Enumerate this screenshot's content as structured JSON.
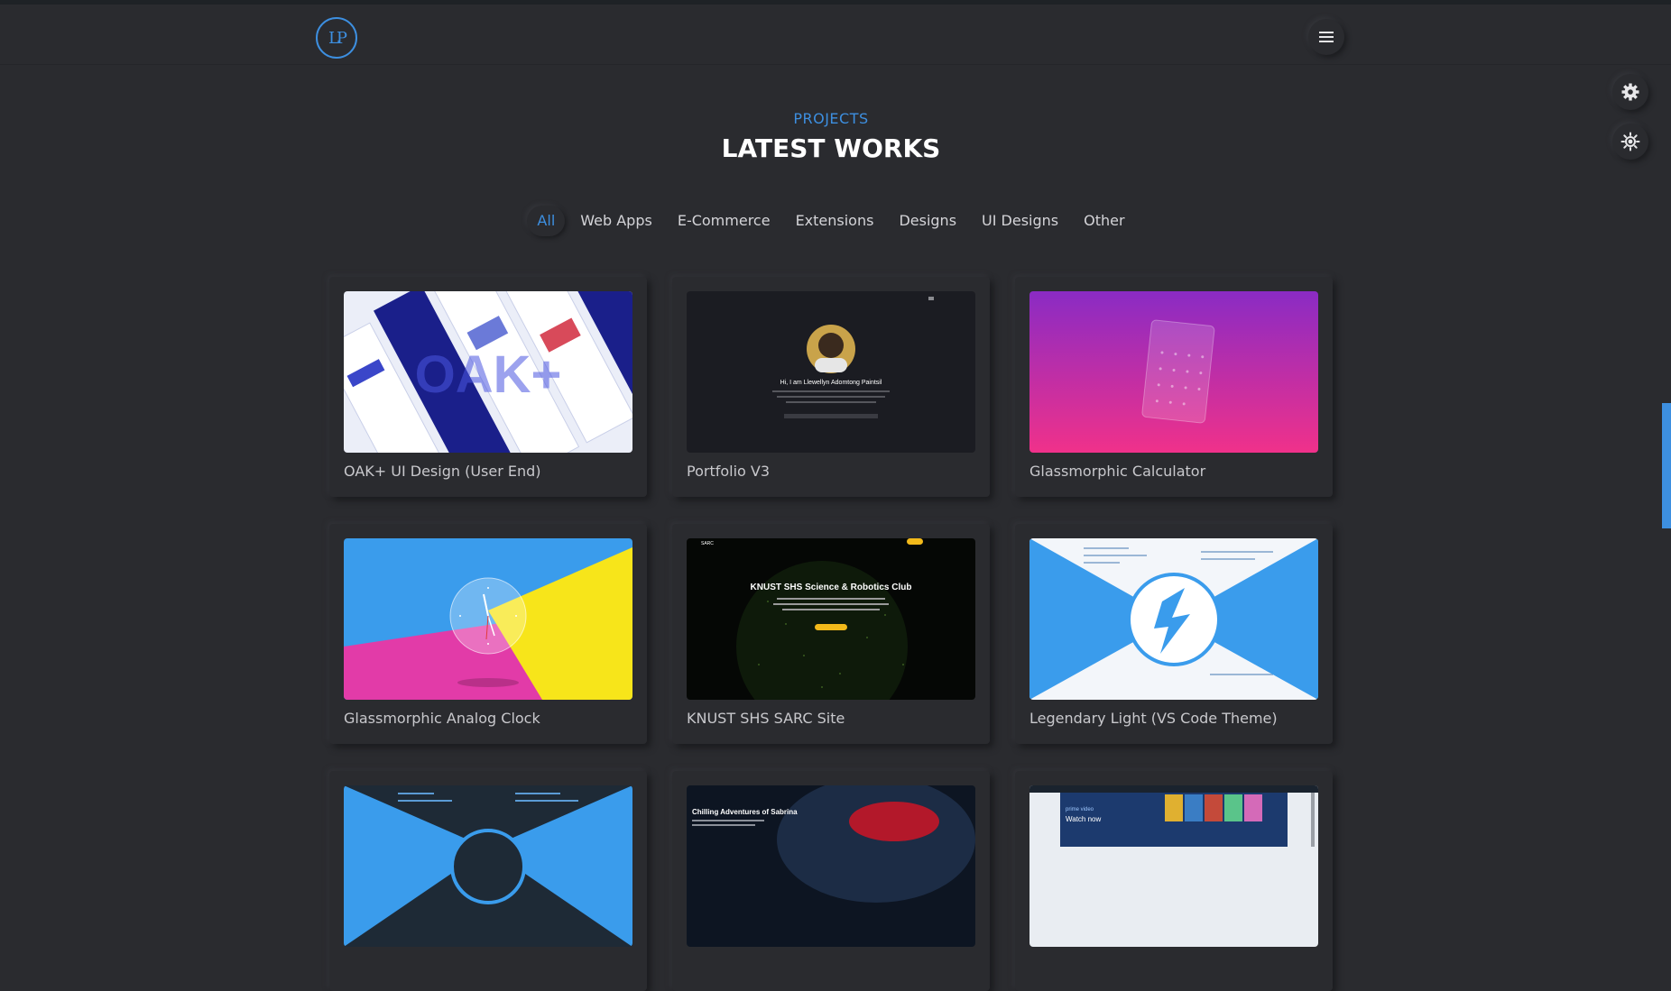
{
  "header": {
    "logo_text": "LP",
    "menu_icon": "hamburger-icon"
  },
  "side_buttons": [
    {
      "icon": "gear-icon"
    },
    {
      "icon": "sun-icon"
    }
  ],
  "section": {
    "kicker": "PROJECTS",
    "title": "LATEST WORKS"
  },
  "filters": [
    "All",
    "Web Apps",
    "E-Commerce",
    "Extensions",
    "Designs",
    "UI Designs",
    "Other"
  ],
  "active_filter": "All",
  "projects": [
    {
      "title": "OAK+ UI Design (User End)",
      "thumb": {
        "overlay": "OAK+"
      }
    },
    {
      "title": "Portfolio V3",
      "thumb": {
        "headline": "Hi, I am Llewellyn Adomtong Paintsil"
      }
    },
    {
      "title": "Glassmorphic Calculator",
      "thumb": {}
    },
    {
      "title": "Glassmorphic Analog Clock",
      "thumb": {}
    },
    {
      "title": "KNUST SHS SARC Site",
      "thumb": {
        "brand": "SARC",
        "headline": "KNUST SHS Science & Robotics Club"
      }
    },
    {
      "title": "Legendary Light (VS Code Theme)",
      "thumb": {}
    },
    {
      "title": "",
      "thumb": {}
    },
    {
      "title": "",
      "thumb": {
        "headline": "Chilling Adventures of Sabrina"
      }
    },
    {
      "title": "",
      "thumb": {
        "brand": "prime video",
        "headline": "Watch now"
      }
    }
  ],
  "colors": {
    "accent": "#3d8fe0",
    "background": "#2a2b2f",
    "heading": "#ffffff"
  }
}
